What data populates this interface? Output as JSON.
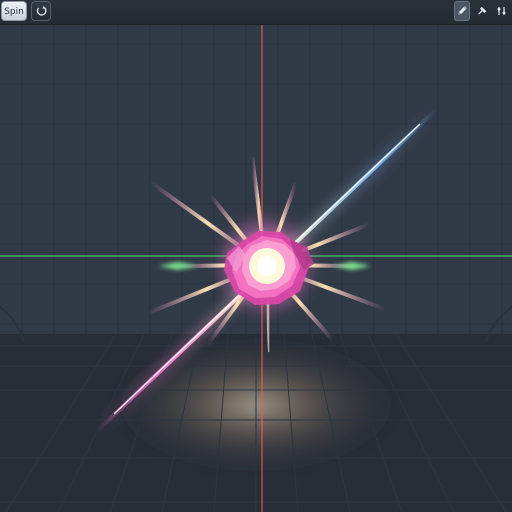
{
  "toolbar": {
    "mode_label": "Spin",
    "rotate_icon": "rotate-icon",
    "pen_icon": "pen-icon",
    "pin_icon": "pin-icon",
    "settings_icon": "slider-icon"
  },
  "scene": {
    "grid_color": "#2a313b",
    "wall_color": "#313a47",
    "floor_color": "#252b34",
    "vertical_guide_color": "#ff5a5a",
    "horizontal_guide_color": "#4cff70",
    "core_color": "#e24cae",
    "glow_color": "#fff7c8",
    "beam_colors": [
      "#ff73d7",
      "#7db7ff",
      "#fff2a8"
    ]
  }
}
